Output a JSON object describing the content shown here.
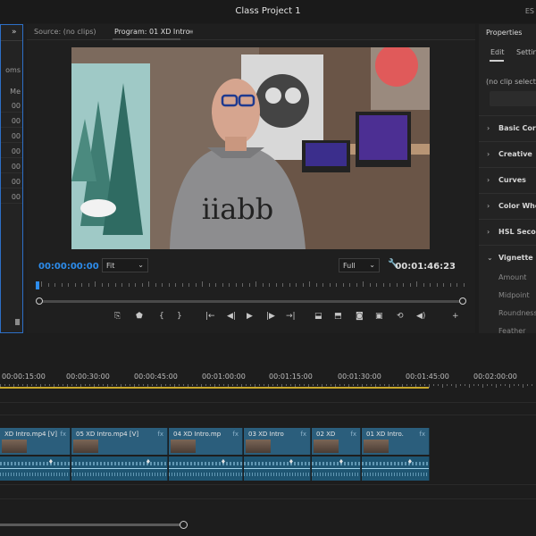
{
  "window": {
    "title": "Class Project 1",
    "workspace_label": "ES"
  },
  "project_panel": {
    "label_items": "oms",
    "label_column": "Me",
    "row_values": [
      "00",
      "00",
      "00",
      "00",
      "00",
      "00",
      "00"
    ],
    "expand_icon": "double-chevron-right-icon"
  },
  "monitor": {
    "source_tab": "Source: (no clips)",
    "program_tab": "Program: 01 XD Intro",
    "menu_icon": "hamburger-icon",
    "timecode_current": "00:00:00:00",
    "zoom_dropdown": "Fit",
    "quality_dropdown": "Full",
    "timecode_duration": "00:01:46:23",
    "settings_icon": "wrench-icon",
    "controls": [
      {
        "name": "export-frame-icon",
        "glyph": "⎘"
      },
      {
        "name": "add-marker-icon",
        "glyph": "⬟"
      },
      {
        "name": "mark-in-icon",
        "glyph": "{"
      },
      {
        "name": "mark-out-icon",
        "glyph": "}"
      },
      {
        "name": "go-to-in-icon",
        "glyph": "|←"
      },
      {
        "name": "step-back-icon",
        "glyph": "◀|"
      },
      {
        "name": "play-icon",
        "glyph": "▶"
      },
      {
        "name": "step-forward-icon",
        "glyph": "|▶"
      },
      {
        "name": "go-to-out-icon",
        "glyph": "→|"
      },
      {
        "name": "lift-icon",
        "glyph": "⬓"
      },
      {
        "name": "extract-icon",
        "glyph": "⬒"
      },
      {
        "name": "camera-icon",
        "glyph": "◙"
      },
      {
        "name": "compare-icon",
        "glyph": "▣"
      },
      {
        "name": "loop-icon",
        "glyph": "⟲"
      },
      {
        "name": "volume-icon",
        "glyph": "◀)"
      },
      {
        "name": "add-button-icon",
        "glyph": "+"
      }
    ]
  },
  "properties": {
    "title": "Properties",
    "tabs": [
      "Edit",
      "Setting"
    ],
    "no_clip_text": "(no clip selected)",
    "sections": [
      "Basic Correc",
      "Creative",
      "Curves",
      "Color Wheel",
      "HSL Second",
      "Vignette"
    ],
    "vignette_items": [
      "Amount",
      "Midpoint",
      "Roundness",
      "Feather"
    ]
  },
  "timeline": {
    "timecodes": [
      "00:00:15:00",
      "00:00:30:00",
      "00:00:45:00",
      "00:01:00:00",
      "00:01:15:00",
      "00:01:30:00",
      "00:01:45:00",
      "00:02:00:00"
    ],
    "video_clips": [
      "XD Intro.mp4 [V]",
      "05 XD Intro.mp4 [V]",
      "04 XD Intro.mp",
      "03 XD Intro",
      "02 XD",
      "01 XD Intro."
    ],
    "fx_label": "fx",
    "keyframe_icon": "♦"
  },
  "colors": {
    "accent": "#2d8ceb",
    "clip_video": "#2b5e7c",
    "clip_audio": "#1e5572",
    "work_area": "#c8a82b"
  }
}
